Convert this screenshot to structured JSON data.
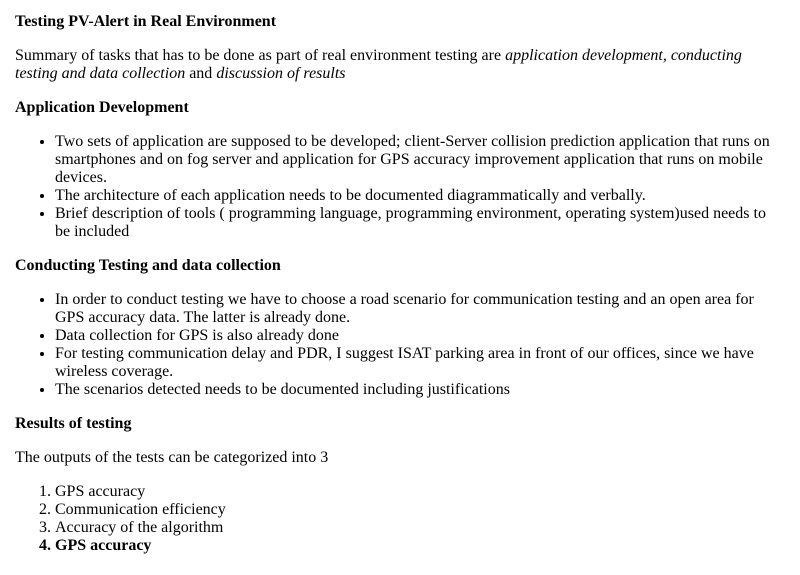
{
  "doc": {
    "title": "Testing PV-Alert in Real Environment",
    "summary": {
      "prefix": "Summary of tasks that has to be done as part of real environment testing are ",
      "em1": "application development, conducting testing and data collection",
      "and": " and ",
      "em2": "discussion of results"
    },
    "app_dev": {
      "heading": "Application Development",
      "items": [
        "Two sets of application are supposed to be developed; client-Server collision prediction application that runs on smartphones and on fog server and application for GPS accuracy improvement application that runs on mobile devices.",
        "The architecture of each application needs to be documented diagrammatically and verbally.",
        "Brief description of tools ( programming language, programming environment, operating system)used needs to be included"
      ]
    },
    "testing": {
      "heading": "Conducting Testing and data collection",
      "items": [
        "In order to conduct testing we have to choose a road scenario for communication testing and an open area for GPS accuracy data. The latter is already done.",
        "Data collection for GPS is also already done",
        "For testing communication delay and PDR, I suggest ISAT parking area in front of our offices, since we have wireless coverage.",
        "The scenarios detected needs to be documented including justifications"
      ]
    },
    "results": {
      "heading": "Results of testing",
      "intro": "The outputs of the tests can be categorized into 3",
      "items": [
        "GPS accuracy",
        "Communication efficiency",
        "Accuracy of the algorithm",
        "GPS accuracy"
      ]
    }
  }
}
